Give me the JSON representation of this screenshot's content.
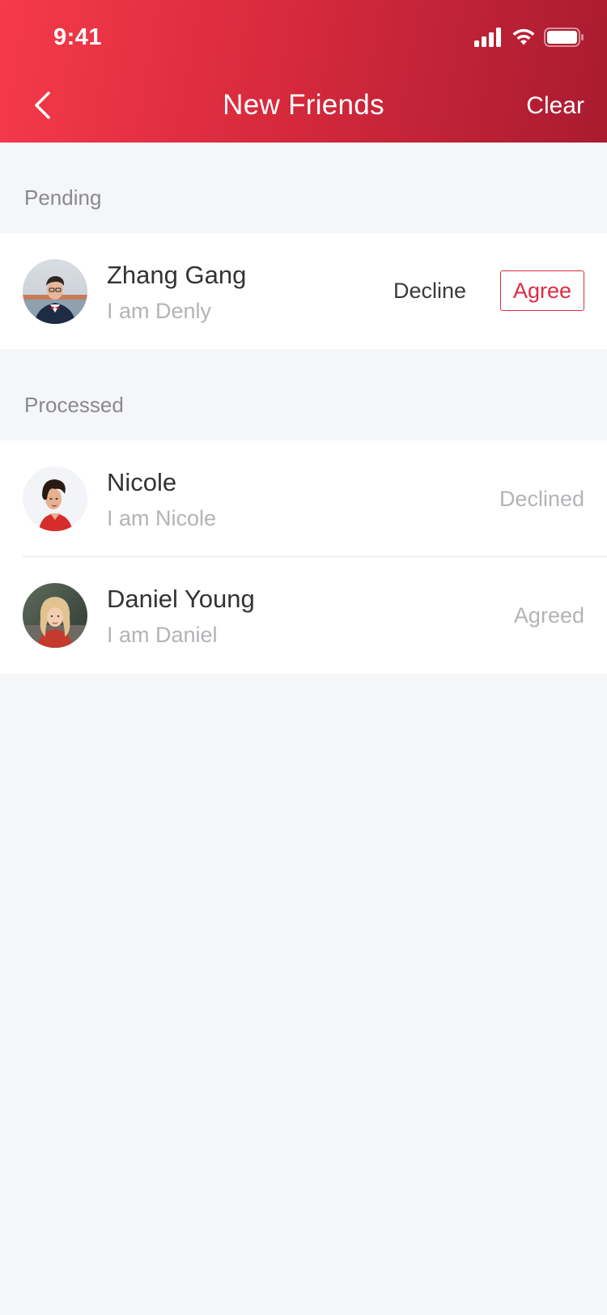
{
  "status_bar": {
    "time": "9:41"
  },
  "nav": {
    "title": "New Friends",
    "clear_label": "Clear"
  },
  "pending": {
    "section_label": "Pending",
    "items": [
      {
        "name": "Zhang Gang",
        "message": "I am Denly",
        "decline_label": "Decline",
        "agree_label": "Agree"
      }
    ]
  },
  "processed": {
    "section_label": "Processed",
    "items": [
      {
        "name": "Nicole",
        "message": "I am Nicole",
        "status": "Declined"
      },
      {
        "name": "Daniel Young",
        "message": "I am Daniel",
        "status": "Agreed"
      }
    ]
  },
  "colors": {
    "accent": "#e12a3f",
    "header_gradient_start": "#f53a4a",
    "header_gradient_end": "#a91b30",
    "background": "#f5f6f8"
  }
}
